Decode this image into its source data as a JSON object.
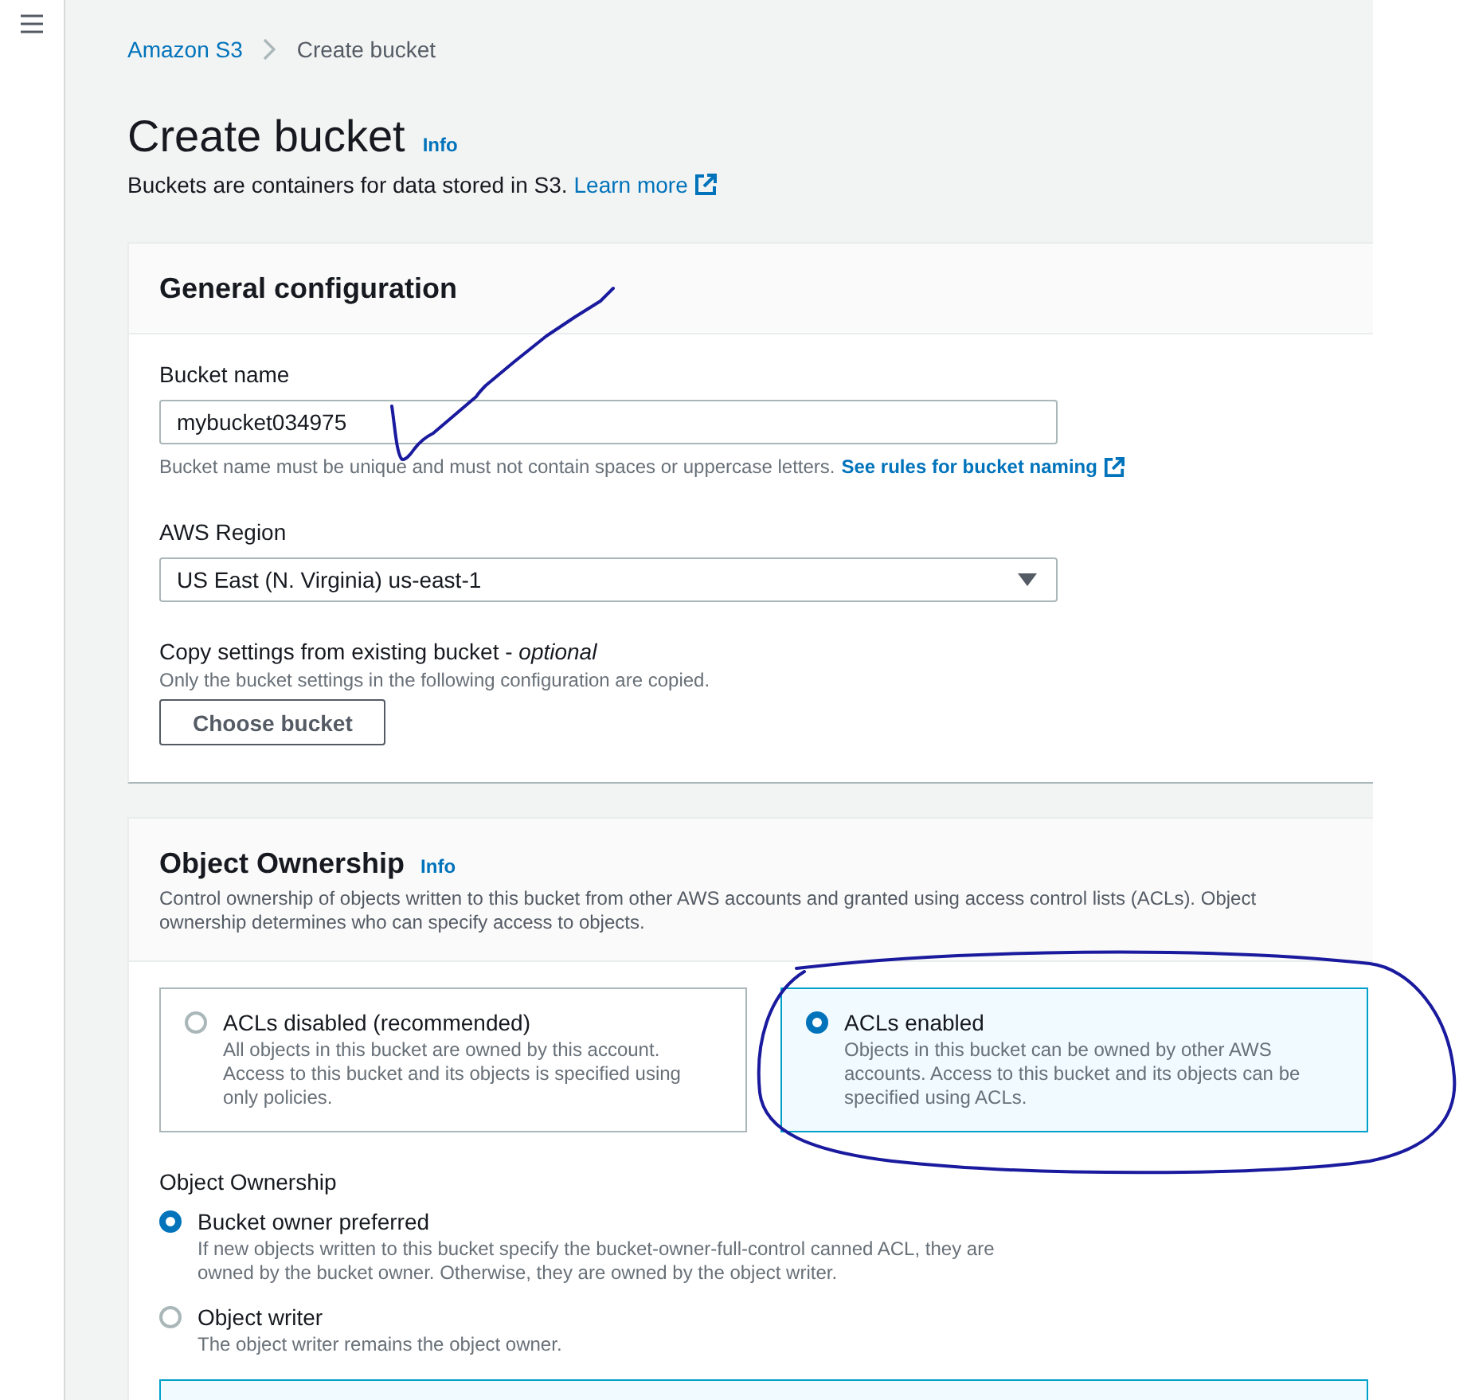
{
  "breadcrumbs": [
    {
      "label": "Amazon S3",
      "kind": "link"
    },
    {
      "label": "Create bucket",
      "kind": "current"
    }
  ],
  "header": {
    "title": "Create bucket",
    "info": "Info",
    "description": "Buckets are containers for data stored in S3.",
    "link": "Learn more"
  },
  "general_configuration": {
    "title": "General configuration",
    "bucket_name": {
      "label": "Bucket name",
      "value": "mybucket034975",
      "hand_checked": true,
      "hint": "Bucket name must be unique and must not contain spaces or uppercase letters.",
      "hint_link": "See rules for bucket naming"
    },
    "aws_region": {
      "label": "AWS Region",
      "value": "US East (N. Virginia) us-east-1"
    },
    "copy_settings": {
      "label": "Copy settings from existing bucket - *optional*",
      "hint": "Only the bucket settings in the following configuration are copied.",
      "button": "Choose bucket"
    }
  },
  "object_ownership": {
    "title": "Object Ownership",
    "info": "Info",
    "description": "Control ownership of objects written to this bucket from other AWS accounts and granted using access control lists (ACLs). Object ownership determines who can specify access to objects.",
    "tiles": [
      {
        "title": "ACLs disabled (recommended)",
        "description": "All objects in this bucket are owned by this account. Access to this bucket and its objects is specified using only policies.",
        "selected": false,
        "hand_circled": false
      },
      {
        "title": "ACLs enabled",
        "description": "Objects in this bucket can be owned by other AWS accounts. Access to this bucket and its objects can be specified using ACLs.",
        "selected": true,
        "hand_circled": true
      }
    ],
    "ownership_label": "Object Ownership",
    "options": [
      {
        "label": "Bucket owner preferred",
        "description": "If new objects written to this bucket specify the bucket-owner-full-control canned ACL, they are owned by the bucket owner. Otherwise, they are owned by the object writer.",
        "selected": true
      },
      {
        "label": "Object writer",
        "description": "The object writer remains the object owner.",
        "selected": false
      }
    ]
  }
}
